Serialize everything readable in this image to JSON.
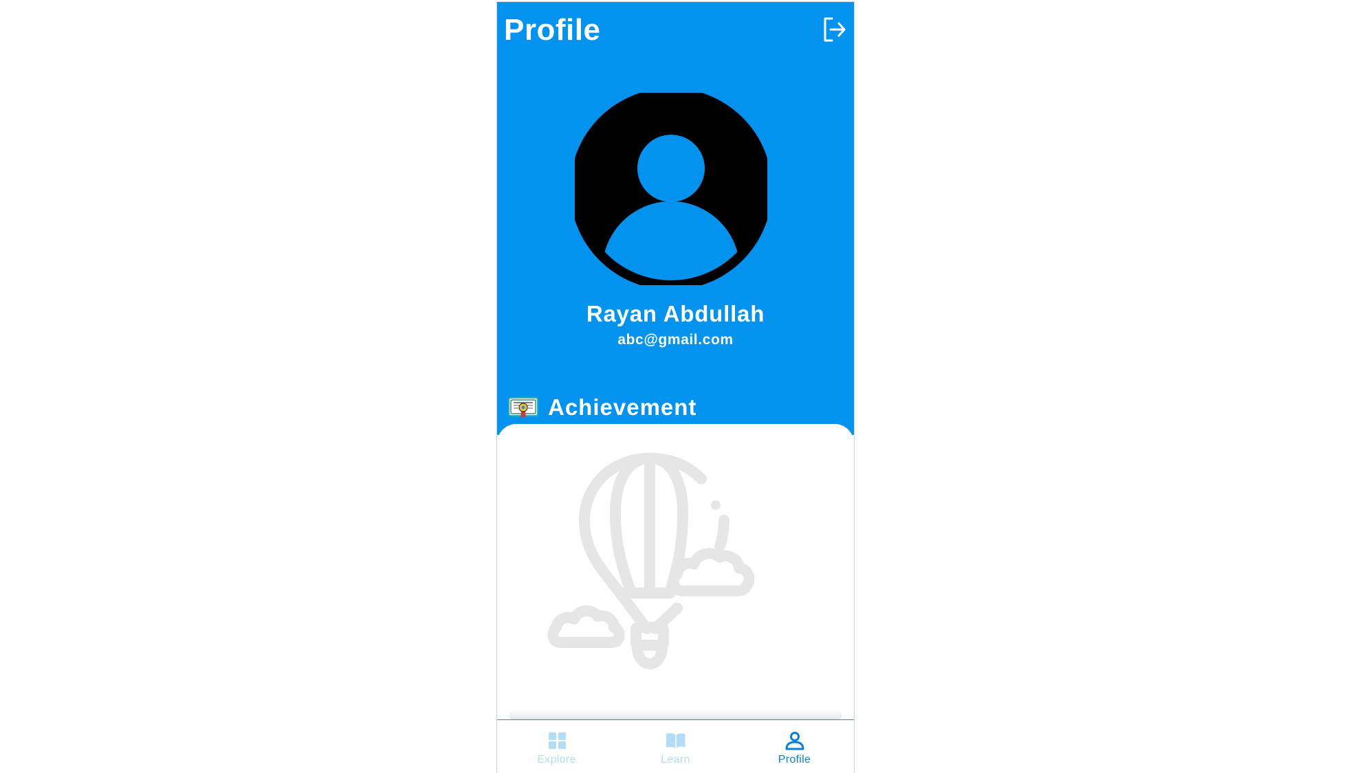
{
  "header": {
    "title": "Profile",
    "logout_icon": "logout-icon"
  },
  "profile": {
    "name": "Rayan Abdullah",
    "email": "abc@gmail.com",
    "avatar_icon": "default-avatar-icon"
  },
  "achievement": {
    "title": "Achievement",
    "icon": "certificate-icon",
    "empty_state_icon": "hot-air-balloon-icon"
  },
  "bottom_nav": {
    "items": [
      {
        "label": "Explore",
        "icon": "grid-icon",
        "active": false
      },
      {
        "label": "Learn",
        "icon": "book-icon",
        "active": false
      },
      {
        "label": "Profile",
        "icon": "person-icon",
        "active": true
      }
    ]
  },
  "colors": {
    "primary": "#0393ee",
    "nav_active": "#0a7fd2",
    "nav_inactive": "#b3dcf9",
    "illustration": "#e6e6e6"
  }
}
